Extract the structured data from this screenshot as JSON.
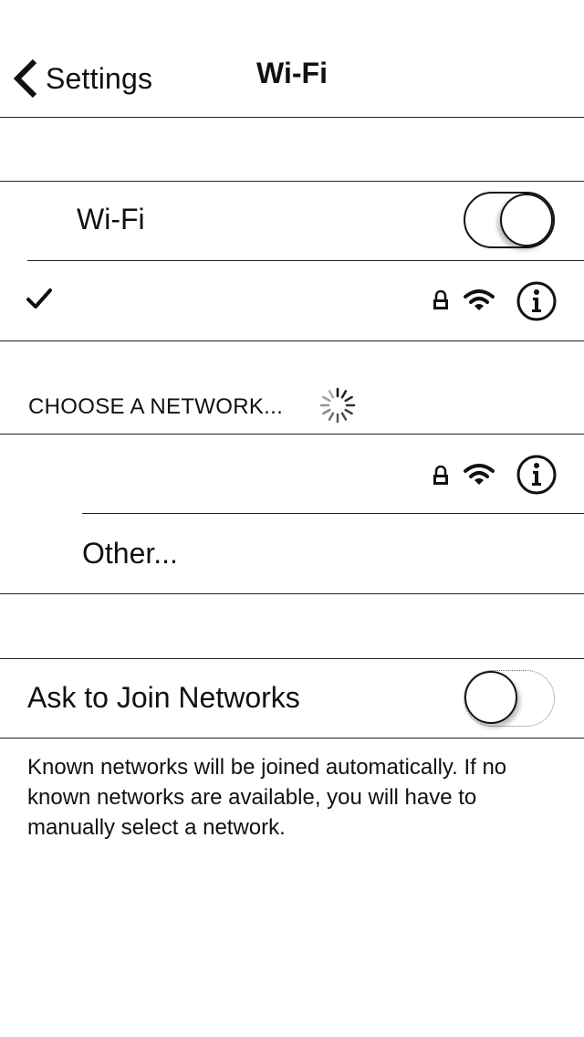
{
  "nav": {
    "back_label": "Settings",
    "title": "Wi-Fi"
  },
  "wifi_toggle": {
    "label": "Wi-Fi",
    "state": "on"
  },
  "connected_network": {
    "name": "",
    "checked": true,
    "icons": [
      "checkmark-icon",
      "lock-icon",
      "wifi-signal-icon",
      "info-icon"
    ]
  },
  "choose_section": {
    "header": "CHOOSE A NETWORK...",
    "loading": true
  },
  "networks": [
    {
      "name": "",
      "icons": [
        "lock-icon",
        "wifi-signal-icon",
        "info-icon"
      ]
    }
  ],
  "other": {
    "label": "Other..."
  },
  "ask_to_join": {
    "label": "Ask to Join Networks",
    "state": "off"
  },
  "footer": {
    "text": "Known networks will be joined automatically. If no known networks are available, you will have to manually select a network."
  }
}
